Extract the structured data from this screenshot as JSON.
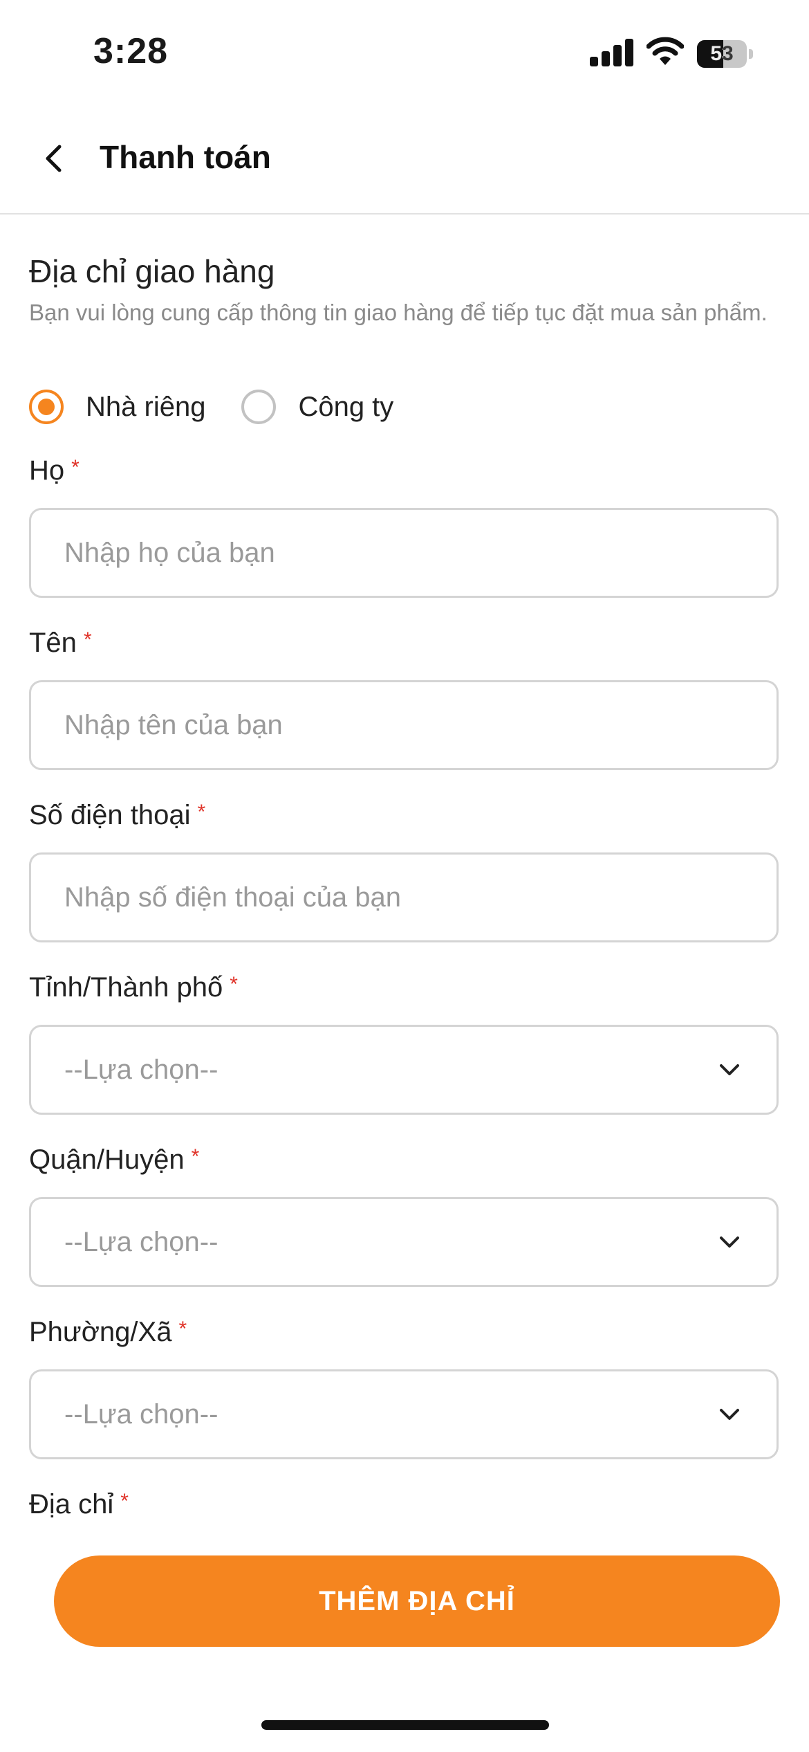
{
  "status_bar": {
    "time": "3:28",
    "battery": "53",
    "battery_level": 0.53
  },
  "header": {
    "title": "Thanh toán"
  },
  "section": {
    "title": "Địa chỉ giao hàng",
    "description": "Bạn vui lòng cung cấp thông tin giao hàng để tiếp tục đặt mua sản phẩm."
  },
  "address_type": {
    "options": [
      {
        "label": "Nhà riêng",
        "selected": true
      },
      {
        "label": "Công ty",
        "selected": false
      }
    ]
  },
  "fields": {
    "last_name": {
      "label": "Họ",
      "required_mark": "*",
      "placeholder": "Nhập họ của bạn",
      "value": ""
    },
    "first_name": {
      "label": "Tên",
      "required_mark": "*",
      "placeholder": "Nhập tên của bạn",
      "value": ""
    },
    "phone": {
      "label": "Số điện thoại",
      "required_mark": "*",
      "placeholder": "Nhập số điện thoại của bạn",
      "value": ""
    },
    "province": {
      "label": "Tỉnh/Thành phố",
      "required_mark": "*",
      "value": "--Lựa chọn--"
    },
    "district": {
      "label": "Quận/Huyện",
      "required_mark": "*",
      "value": "--Lựa chọn--"
    },
    "ward": {
      "label": "Phường/Xã",
      "required_mark": "*",
      "value": "--Lựa chọn--"
    },
    "address": {
      "label": "Địa chỉ",
      "required_mark": "*"
    }
  },
  "submit": {
    "label": "THÊM ĐỊA CHỈ"
  },
  "colors": {
    "accent": "#f5851f",
    "required": "#e0342a",
    "border": "#d4d4d4",
    "placeholder": "#9a9a9a"
  }
}
